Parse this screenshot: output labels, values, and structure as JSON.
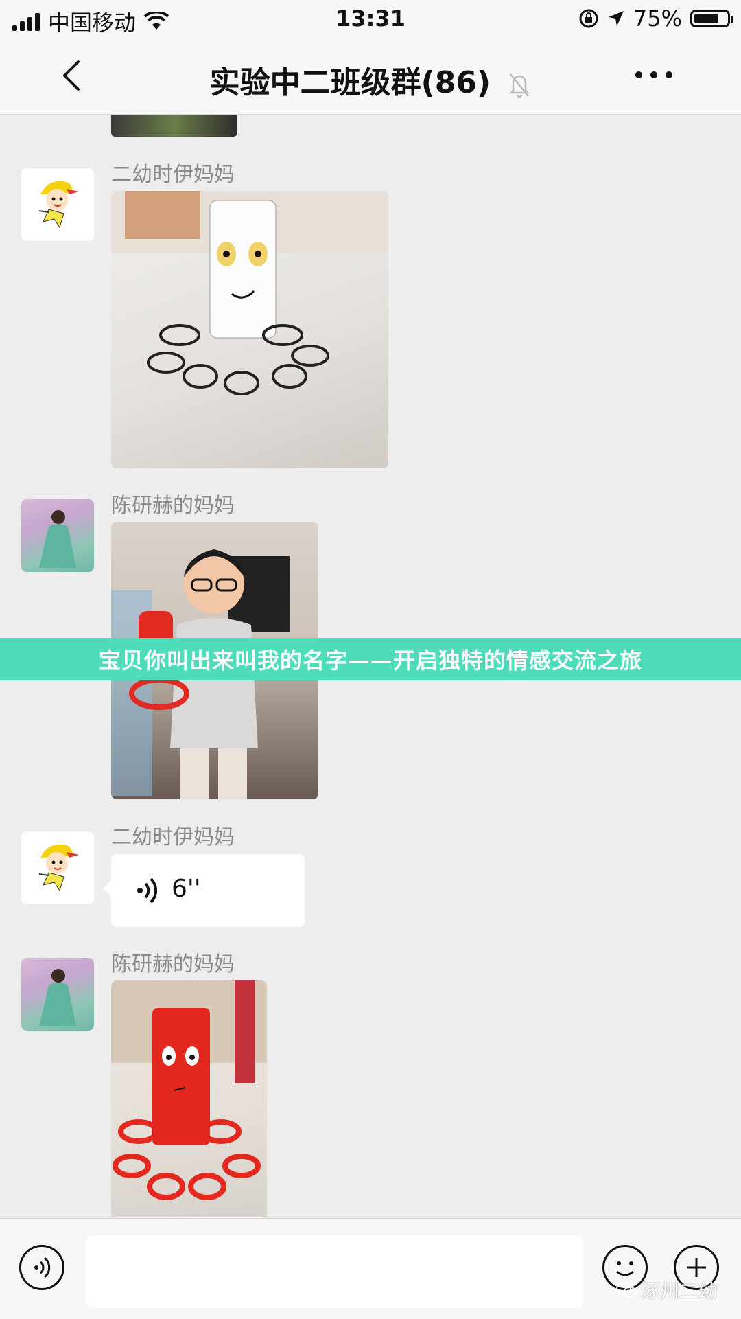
{
  "status_bar": {
    "carrier": "中国移动",
    "time": "13:31",
    "battery_percent": "75%",
    "battery_level": 0.75
  },
  "nav": {
    "title": "实验中二班级群(86)",
    "back_icon": "chevron-left-icon",
    "mute_icon": "bell-muted-icon",
    "more_icon": "more-dots-icon"
  },
  "messages": [
    {
      "sender": "二幼时伊妈妈",
      "type": "image",
      "content": "paper octopus craft (white)"
    },
    {
      "sender": "陈研赫的妈妈",
      "type": "image",
      "content": "child holding red paper octopus"
    },
    {
      "sender": "二幼时伊妈妈",
      "type": "voice",
      "duration": "6''"
    },
    {
      "sender": "陈研赫的妈妈",
      "type": "image",
      "content": "red paper octopus craft"
    }
  ],
  "banner": {
    "text": "宝贝你叫出来叫我的名字——开启独特的情感交流之旅",
    "color": "#4fdcbb"
  },
  "input_bar": {
    "voice_icon": "voice-mode-icon",
    "emoji_icon": "emoji-icon",
    "plus_icon": "plus-icon",
    "watermark": "涿州二幼"
  }
}
